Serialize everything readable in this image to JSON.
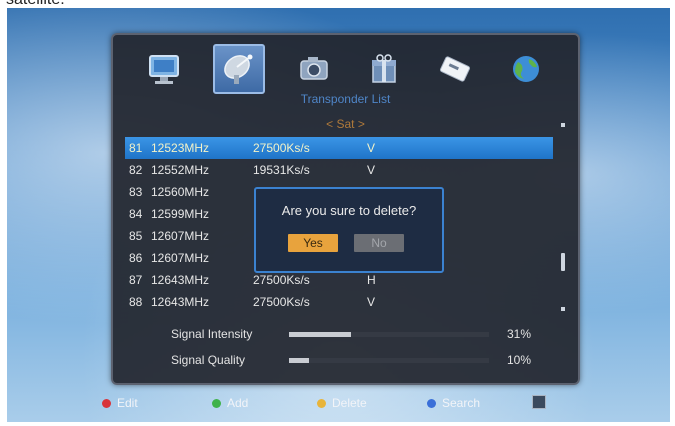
{
  "caption": "satellite.",
  "menu": {
    "icons": [
      "monitor-icon",
      "satellite-dish-icon",
      "camera-icon",
      "gift-box-icon",
      "card-icon",
      "globe-icon"
    ],
    "active_index": 1
  },
  "title": "Transponder List",
  "satellite_label": "< Sat >",
  "transponders": [
    {
      "index": "81",
      "freq": "12523MHz",
      "symbol_rate": "27500Ks/s",
      "pol": "V",
      "selected": true
    },
    {
      "index": "82",
      "freq": "12552MHz",
      "symbol_rate": "19531Ks/s",
      "pol": "V",
      "selected": false
    },
    {
      "index": "83",
      "freq": "12560MHz",
      "symbol_rate": "",
      "pol": "",
      "selected": false
    },
    {
      "index": "84",
      "freq": "12599MHz",
      "symbol_rate": "",
      "pol": "",
      "selected": false
    },
    {
      "index": "85",
      "freq": "12607MHz",
      "symbol_rate": "",
      "pol": "",
      "selected": false
    },
    {
      "index": "86",
      "freq": "12607MHz",
      "symbol_rate": "",
      "pol": "",
      "selected": false
    },
    {
      "index": "87",
      "freq": "12643MHz",
      "symbol_rate": "27500Ks/s",
      "pol": "H",
      "selected": false
    },
    {
      "index": "88",
      "freq": "12643MHz",
      "symbol_rate": "27500Ks/s",
      "pol": "V",
      "selected": false
    }
  ],
  "dialog": {
    "message": "Are you sure to delete?",
    "yes_label": "Yes",
    "no_label": "No"
  },
  "signal": {
    "intensity_label": "Signal Intensity",
    "intensity_value": "31%",
    "intensity_fraction": 0.31,
    "quality_label": "Signal Quality",
    "quality_value": "10%",
    "quality_fraction": 0.1
  },
  "footer": {
    "items": [
      {
        "label": "Edit",
        "color": "#d8333a",
        "icon": "red-dot-icon"
      },
      {
        "label": "Add",
        "color": "#3fb24a",
        "icon": "green-dot-icon"
      },
      {
        "label": "Delete",
        "color": "#e8b43a",
        "icon": "yellow-dot-icon"
      },
      {
        "label": "Search",
        "color": "#3a6fd8",
        "icon": "blue-dot-icon"
      }
    ],
    "exit_icon": "exit-icon"
  },
  "colors": {
    "selected_row": "#2a86da",
    "dialog_border": "#3b82d0",
    "yes_button": "#e8a33d",
    "no_button": "#6b6e74"
  }
}
